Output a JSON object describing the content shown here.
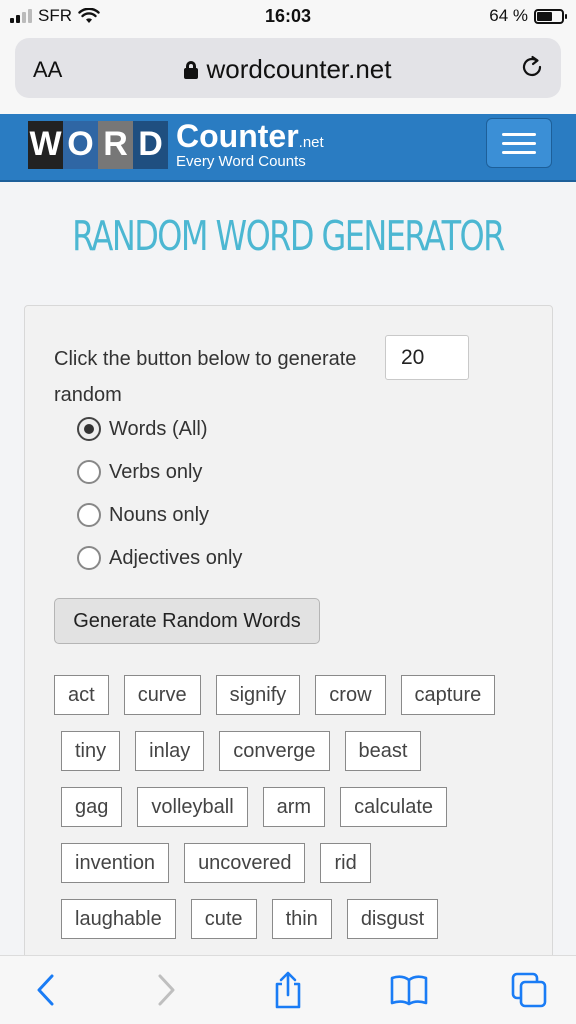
{
  "status_bar": {
    "carrier": "SFR",
    "time": "16:03",
    "battery": "64 %",
    "battery_level": 0.64
  },
  "browser": {
    "aa_label": "AA",
    "url": "wordcounter.net"
  },
  "site_header": {
    "logo_letters": [
      "W",
      "O",
      "R",
      "D"
    ],
    "brand": "Counter",
    "brand_suffix": ".net",
    "tagline": "Every Word Counts"
  },
  "page": {
    "title": "RANDOM WORD GENERATOR"
  },
  "generator": {
    "intro_text": "Click the button below to generate",
    "intro_text_2": "random",
    "count_value": "20",
    "options": [
      {
        "label": "Words (All)",
        "checked": true
      },
      {
        "label": "Verbs only",
        "checked": false
      },
      {
        "label": "Nouns only",
        "checked": false
      },
      {
        "label": "Adjectives only",
        "checked": false
      }
    ],
    "button_label": "Generate Random Words"
  },
  "words": [
    [
      "act",
      "curve",
      "signify",
      "crow",
      "capture"
    ],
    [
      "tiny",
      "inlay",
      "converge",
      "beast"
    ],
    [
      "gag",
      "volleyball",
      "arm",
      "calculate"
    ],
    [
      "invention",
      "uncovered",
      "rid"
    ],
    [
      "laughable",
      "cute",
      "thin",
      "disgust"
    ]
  ],
  "toolbar_icons": [
    "back-icon",
    "forward-icon",
    "share-icon",
    "bookmarks-icon",
    "tabs-icon"
  ]
}
